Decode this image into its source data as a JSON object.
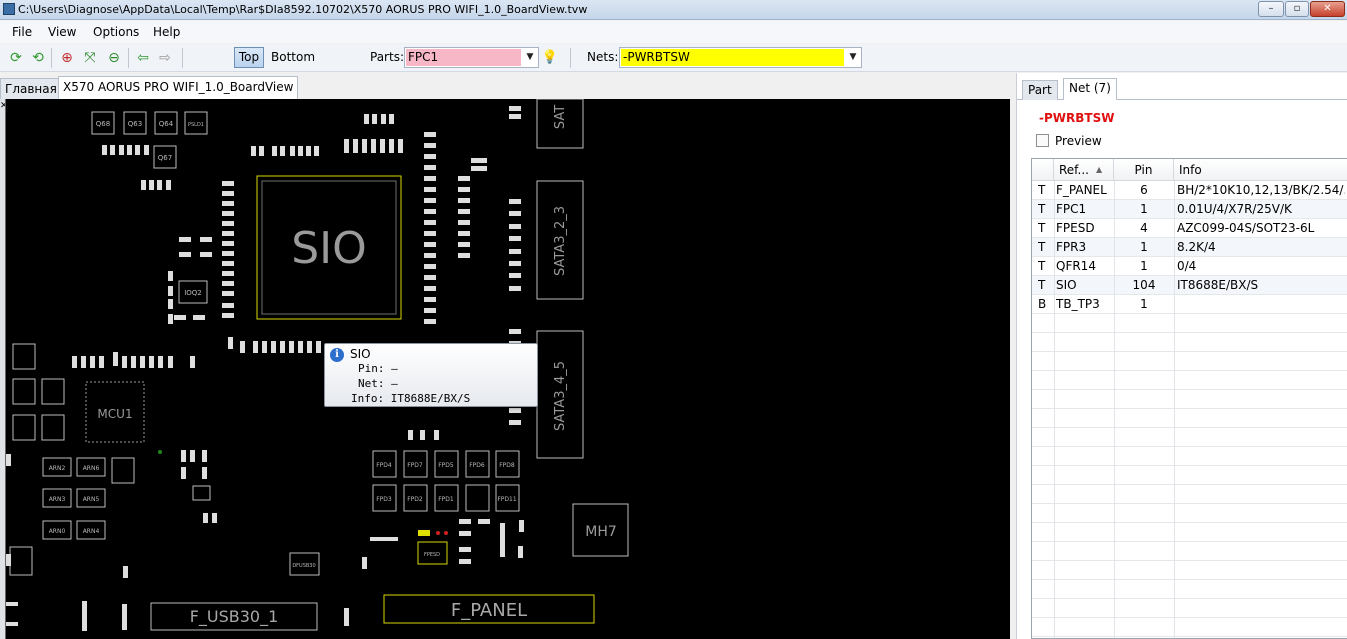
{
  "window": {
    "title": "C:\\Users\\Diagnose\\AppData\\Local\\Temp\\Rar$DIa8592.10702\\X570 AORUS PRO WIFI_1.0_BoardView.tvw",
    "minimize": "–",
    "maximize": "▫",
    "close": "✕"
  },
  "menu": [
    "File",
    "View",
    "Options",
    "Help"
  ],
  "toolbar": {
    "top_label": "Top",
    "bottom_label": "Bottom",
    "parts_label": "Parts:",
    "parts_value": "FPC1",
    "nets_label": "Nets:",
    "nets_value": "-PWRBTSW",
    "parts_bg": "#f7b7c6",
    "nets_bg": "#ffff00",
    "icons": [
      "refresh-icon",
      "refresh-alt-icon",
      "zoom-in-icon",
      "fit-icon",
      "zoom-out-icon",
      "back-arrow-icon",
      "forward-arrow-icon",
      "bulb-icon"
    ]
  },
  "tabs": [
    {
      "label": "Главная"
    },
    {
      "label": "X570 AORUS PRO WIFI_1.0_BoardView"
    }
  ],
  "board": {
    "labels": {
      "sio": "SIO",
      "mcu": "MCU1",
      "mh7": "MH7",
      "f_usb": "F_USB30_1",
      "f_panel": "F_PANEL",
      "sata23": "SATA3_2_3",
      "sata45": "SATA3_4_5",
      "sata_top": "SAT",
      "q68": "Q68",
      "q63": "Q63",
      "q64": "Q64",
      "q67": "Q67",
      "psld1": "PSLD1",
      "ioq2": "IOQ2",
      "arn2": "ARN2",
      "arn6": "ARN6",
      "arn3": "ARN3",
      "arn5": "ARN5",
      "arn0": "ARN0",
      "arn4": "ARN4",
      "fpd4": "FPD4",
      "fpd7": "FPD7",
      "fpd5": "FPD5",
      "fpd6": "FPD6",
      "fpd8": "FPD8",
      "fpd3": "FPD3",
      "fpd2": "FPD2",
      "fpd1": "FPD1",
      "fpd11": "FPD11",
      "fpesd": "FPESD",
      "dfusb": "DFUSB30"
    },
    "highlight_color": "#e0e000"
  },
  "tooltip": {
    "title": "SIO",
    "pin": "Pin: –",
    "net": "Net: –",
    "info": "Info: IT8688E/BX/S"
  },
  "right_panel": {
    "tab_part": "Part",
    "tab_net": "Net (7)",
    "net_name": "-PWRBTSW",
    "preview": "Preview",
    "columns": [
      "Ref...",
      "Pin",
      "Info"
    ],
    "rows": [
      {
        "side": "T",
        "ref": "F_PANEL",
        "pin": "6",
        "info": "BH/2*10K10,12,13/BK/2.54/..."
      },
      {
        "side": "T",
        "ref": "FPC1",
        "pin": "1",
        "info": "0.01U/4/X7R/25V/K"
      },
      {
        "side": "T",
        "ref": "FPESD",
        "pin": "4",
        "info": "AZC099-04S/SOT23-6L"
      },
      {
        "side": "T",
        "ref": "FPR3",
        "pin": "1",
        "info": "8.2K/4"
      },
      {
        "side": "T",
        "ref": "QFR14",
        "pin": "1",
        "info": "0/4"
      },
      {
        "side": "T",
        "ref": "SIO",
        "pin": "104",
        "info": "IT8688E/BX/S"
      },
      {
        "side": "B",
        "ref": "TB_TP3",
        "pin": "1",
        "info": ""
      }
    ]
  }
}
